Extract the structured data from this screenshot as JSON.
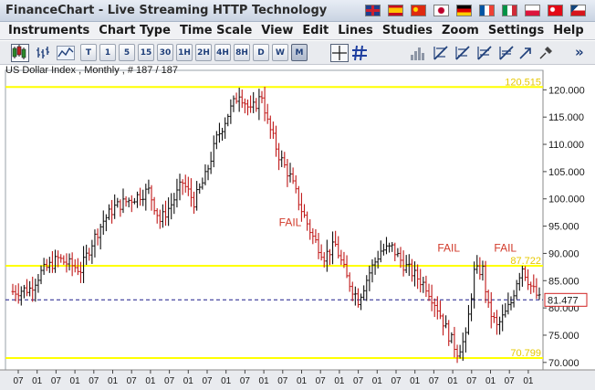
{
  "app": {
    "title": "FinanceChart - Live Streaming HTTP Technology",
    "language_flags": [
      {
        "name": "uk-flag-icon",
        "colors": [
          "#1e3f8f",
          "#ffffff",
          "#cc1f2f"
        ]
      },
      {
        "name": "spain-flag-icon",
        "colors": [
          "#c60b1e",
          "#ffc400",
          "#c60b1e"
        ]
      },
      {
        "name": "china-flag-icon",
        "colors": [
          "#de2910",
          "#de2910",
          "#ffde00"
        ]
      },
      {
        "name": "japan-flag-icon",
        "colors": [
          "#ffffff",
          "#ffffff",
          "#bc002d"
        ]
      },
      {
        "name": "germany-flag-icon",
        "colors": [
          "#000000",
          "#dd0000",
          "#ffce00"
        ]
      },
      {
        "name": "france-flag-icon",
        "colors": [
          "#0055a4",
          "#ffffff",
          "#ef4135"
        ]
      },
      {
        "name": "italy-flag-icon",
        "colors": [
          "#009246",
          "#ffffff",
          "#ce2b37"
        ]
      },
      {
        "name": "poland-flag-icon",
        "colors": [
          "#ffffff",
          "#dc143c",
          "#dc143c"
        ]
      },
      {
        "name": "turkey-flag-icon",
        "colors": [
          "#e30a17",
          "#e30a17",
          "#ffffff"
        ]
      },
      {
        "name": "czech-flag-icon",
        "colors": [
          "#ffffff",
          "#d7141a",
          "#11457e"
        ]
      }
    ]
  },
  "menu": {
    "items": [
      "Instruments",
      "Chart Type",
      "Time Scale",
      "View",
      "Edit",
      "Lines",
      "Studies",
      "Zoom",
      "Settings",
      "Help"
    ]
  },
  "toolbar": {
    "chart_type_icons": [
      "candlestick-chart-icon",
      "bar-chart-icon",
      "line-chart-icon"
    ],
    "timeframes": [
      "T",
      "1",
      "5",
      "15",
      "30",
      "1H",
      "2H",
      "4H",
      "8H",
      "D",
      "W",
      "M"
    ],
    "active_timeframe": "M",
    "tool_icons": [
      "crosshair-icon",
      "grid-icon",
      "volume-icon",
      "trendline-tool-icon",
      "channel-tool-icon",
      "fibonacci-tool-icon",
      "gann-tool-icon",
      "arrow-tool-icon",
      "pin-tool-icon"
    ],
    "more_label": "»"
  },
  "chart_data": {
    "type": "ohlc-bar",
    "symbol_label": "US Dollar Index , Monthly , # 187 / 187",
    "y_ticks": [
      "120.000",
      "115.000",
      "110.000",
      "105.000",
      "100.000",
      "95.000",
      "90.000",
      "85.000",
      "80.000",
      "75.000",
      "70.000"
    ],
    "y_tick_values": [
      120,
      115,
      110,
      105,
      100,
      95,
      90,
      85,
      80,
      75,
      70
    ],
    "ylim": [
      69.3,
      121.9
    ],
    "x_tick_labels": [
      "07",
      "01",
      "07",
      "01",
      "07",
      "01",
      "07",
      "01",
      "07",
      "01",
      "07",
      "01",
      "07",
      "01",
      "07",
      "01",
      "07",
      "01",
      "07",
      "01",
      "07",
      "01",
      "07",
      "01",
      "07",
      "01",
      "07",
      "01",
      "07"
    ],
    "horizontal_lines": [
      {
        "value": 120.515,
        "label": "120.515",
        "color": "#ffff00"
      },
      {
        "value": 87.722,
        "label": "87.722",
        "color": "#ffff00"
      },
      {
        "value": 70.799,
        "label": "70.799",
        "color": "#ffff00"
      }
    ],
    "last_price": {
      "value": 81.477,
      "label": "81.477",
      "color": "#1c1c8c"
    },
    "annotations": [
      {
        "text": "FAIL",
        "index": 98,
        "value": 95.0
      },
      {
        "text": "FAIL",
        "index": 154,
        "value": 90.3
      },
      {
        "text": "FAIL",
        "index": 174,
        "value": 90.3
      }
    ],
    "bar_count": 187,
    "anchors": [
      [
        0,
        83.0
      ],
      [
        6,
        83.5
      ],
      [
        10,
        86.5
      ],
      [
        16,
        89.0
      ],
      [
        24,
        87.0
      ],
      [
        28,
        92.0
      ],
      [
        32,
        96.0
      ],
      [
        36,
        98.5
      ],
      [
        42,
        100.0
      ],
      [
        48,
        101.5
      ],
      [
        52,
        96.0
      ],
      [
        56,
        99.0
      ],
      [
        60,
        103.0
      ],
      [
        64,
        99.5
      ],
      [
        68,
        104.0
      ],
      [
        72,
        111.0
      ],
      [
        76,
        115.5
      ],
      [
        80,
        119.5
      ],
      [
        84,
        116.0
      ],
      [
        88,
        119.0
      ],
      [
        90,
        114.0
      ],
      [
        94,
        108.0
      ],
      [
        98,
        104.0
      ],
      [
        102,
        98.0
      ],
      [
        106,
        93.0
      ],
      [
        110,
        89.5
      ],
      [
        114,
        91.5
      ],
      [
        118,
        85.5
      ],
      [
        122,
        81.5
      ],
      [
        126,
        86.5
      ],
      [
        130,
        90.5
      ],
      [
        134,
        91.0
      ],
      [
        138,
        88.0
      ],
      [
        142,
        86.0
      ],
      [
        146,
        84.0
      ],
      [
        150,
        80.0
      ],
      [
        154,
        75.0
      ],
      [
        157,
        72.0
      ],
      [
        160,
        74.5
      ],
      [
        163,
        86.5
      ],
      [
        166,
        87.0
      ],
      [
        168,
        80.0
      ],
      [
        171,
        76.5
      ],
      [
        174,
        79.0
      ],
      [
        176,
        81.0
      ],
      [
        178,
        85.0
      ],
      [
        180,
        87.5
      ],
      [
        183,
        84.0
      ],
      [
        186,
        81.5
      ]
    ]
  }
}
